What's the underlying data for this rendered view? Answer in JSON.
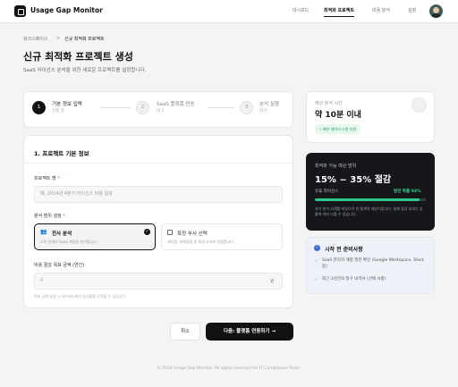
{
  "app": {
    "title": "Usage Gap Monitor"
  },
  "nav": {
    "items": [
      "대시보드",
      "최적화 프로젝트",
      "비용 분석",
      "설정"
    ]
  },
  "breadcrumb": [
    "워크스페이스",
    ">",
    "신규 최적화 프로젝트"
  ],
  "page": {
    "title": "신규 최적화 프로젝트 생성",
    "subtitle": "SaaS 라이선스 분석을 위한 새로운 프로젝트를 설정합니다."
  },
  "stepper": [
    {
      "num": "1",
      "title": "기본 정보 입력",
      "sub": "진행 중",
      "active": true
    },
    {
      "num": "2",
      "title": "SaaS 플랫폼 연동",
      "sub": "대기",
      "active": false
    },
    {
      "num": "3",
      "title": "분석 실행",
      "sub": "대기",
      "active": false
    }
  ],
  "form": {
    "section_title": "1. 프로젝트 기본 정보",
    "project_name": {
      "label": "프로젝트 명",
      "required_mark": "*",
      "placeholder": "예: 2024년 4분기 라이선스 비용 절감",
      "value": ""
    },
    "scope": {
      "label": "분석 범위 설정",
      "required_mark": "*",
      "options": [
        {
          "title": "전사 분석",
          "desc": "조직 전체의 SaaS 계정을 분석합니다.",
          "selected": true
        },
        {
          "title": "특정 부서 선택",
          "desc": "재무팀, 마케팅팀 등 특정 부서로 한정합니다.",
          "selected": false
        }
      ]
    },
    "target": {
      "label": "비용 절감 목표 금액 (연간)",
      "placeholder": "0",
      "unit": "원",
      "hint": "목표 금액 설정 시 대시보드에서 달성률을 추적할 수 있습니다."
    }
  },
  "actions": {
    "cancel": "취소",
    "next": "다음: 플랫폼 연동하기"
  },
  "sidebar": {
    "time_card": {
      "label": "예상 분석 시간",
      "value": "약 10분 이내",
      "badge": "빠른 데이터 스캔 지원"
    },
    "estimate_card": {
      "label": "최적화 가능 예상 범위",
      "value": "15% ~ 35% 절감",
      "sub_left": "유휴 라이선스",
      "sub_right": "발견 확률 94%",
      "progress": 0.94,
      "desc": "과거 분석 사례를 바탕으로 한 통계적 예상치입니다. 실제 절감 효과는 상황에 따라 다를 수 있습니다."
    },
    "checklist": {
      "title": "시작 전 준비사항",
      "items": [
        "SaaS 관리자 계정 권한 확인 (Google Workspace, Slack 등)",
        "최근 1년간의 청구 내역서 (선택 사항)"
      ]
    }
  },
  "footer": "© 2024 Usage Gap Monitor. All rights reserved for IT Compliance Team."
}
